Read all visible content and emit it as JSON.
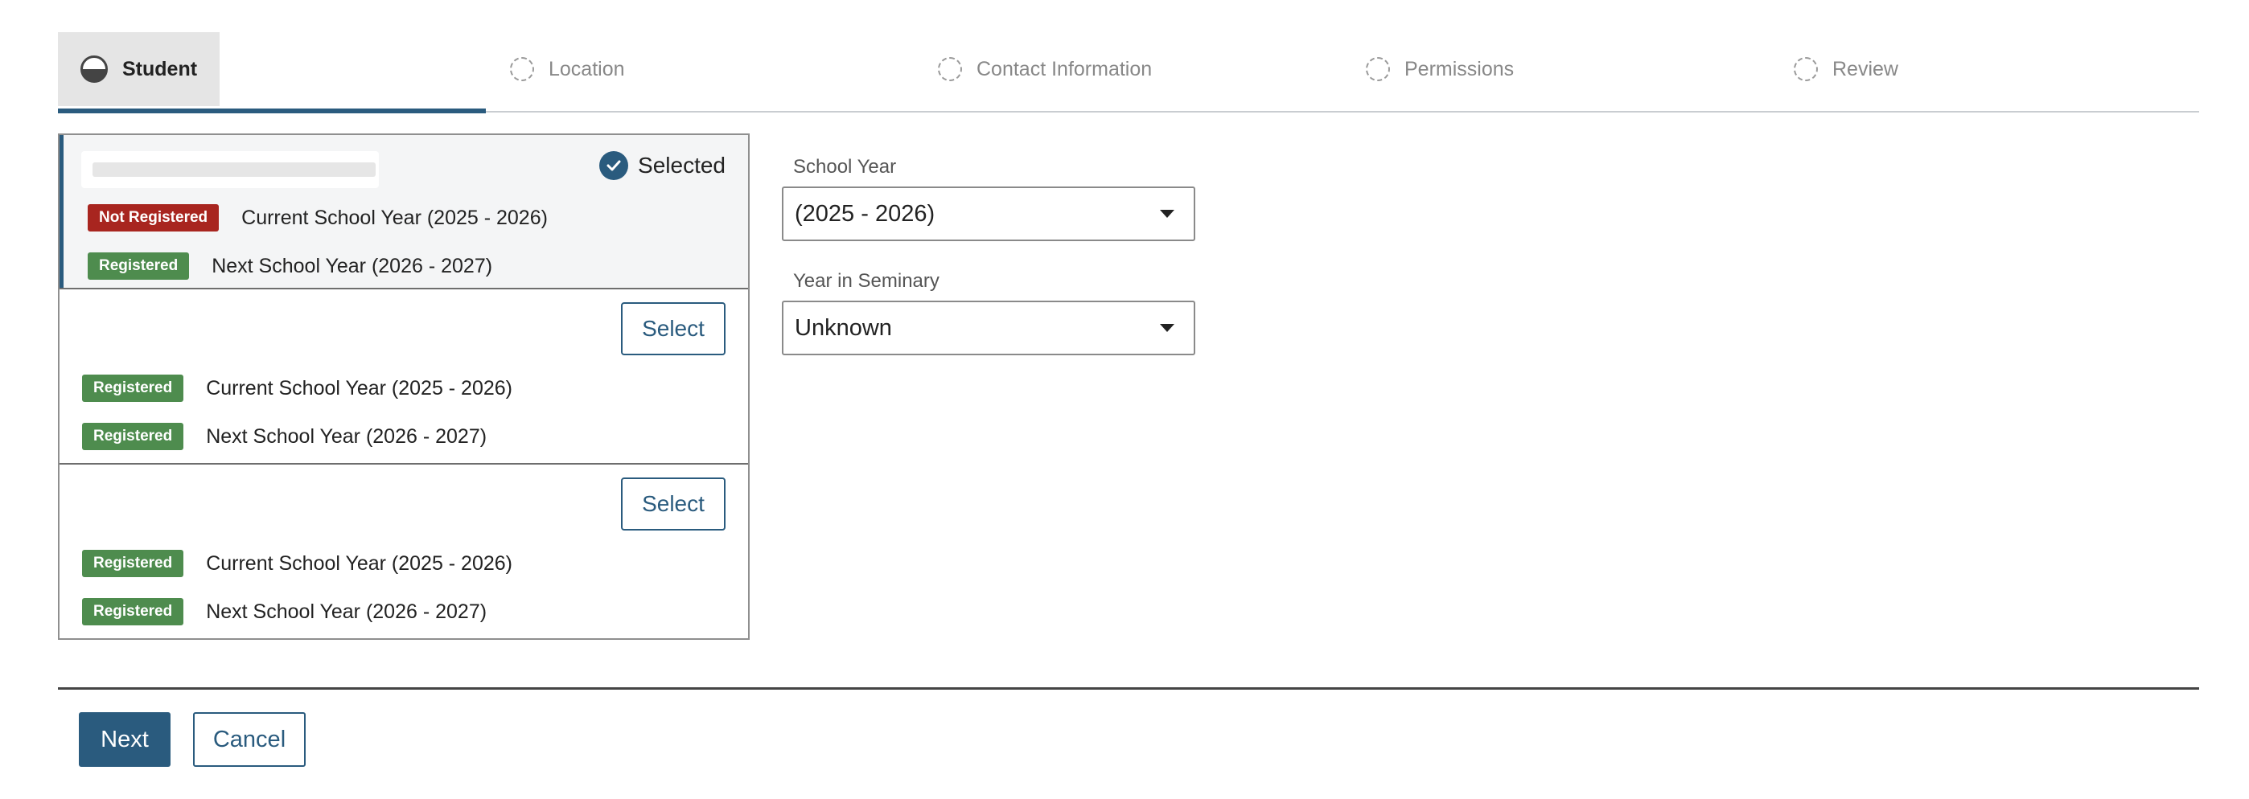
{
  "stepper": {
    "steps": [
      {
        "label": "Student",
        "state": "active"
      },
      {
        "label": "Location",
        "state": "pending"
      },
      {
        "label": "Contact Information",
        "state": "pending"
      },
      {
        "label": "Permissions",
        "state": "pending"
      },
      {
        "label": "Review",
        "state": "pending"
      }
    ]
  },
  "students": [
    {
      "selected": true,
      "selected_label": "Selected",
      "rows": [
        {
          "badge": "Not Registered",
          "status": "red",
          "text": "Current School Year (2025 - 2026)"
        },
        {
          "badge": "Registered",
          "status": "green",
          "text": "Next School Year (2026 - 2027)"
        }
      ]
    },
    {
      "selected": false,
      "select_label": "Select",
      "rows": [
        {
          "badge": "Registered",
          "status": "green",
          "text": "Current School Year (2025 - 2026)"
        },
        {
          "badge": "Registered",
          "status": "green",
          "text": "Next School Year (2026 - 2027)"
        }
      ]
    },
    {
      "selected": false,
      "select_label": "Select",
      "rows": [
        {
          "badge": "Registered",
          "status": "green",
          "text": "Current School Year (2025 - 2026)"
        },
        {
          "badge": "Registered",
          "status": "green",
          "text": "Next School Year (2026 - 2027)"
        }
      ]
    }
  ],
  "form": {
    "school_year": {
      "label": "School Year",
      "value": "(2025 - 2026)"
    },
    "year_in_seminary": {
      "label": "Year in Seminary",
      "value": "Unknown"
    }
  },
  "footer": {
    "next_label": "Next",
    "cancel_label": "Cancel"
  },
  "colors": {
    "primary": "#2a5b7e",
    "registered": "#4e8c4e",
    "not_registered": "#a8251f"
  }
}
